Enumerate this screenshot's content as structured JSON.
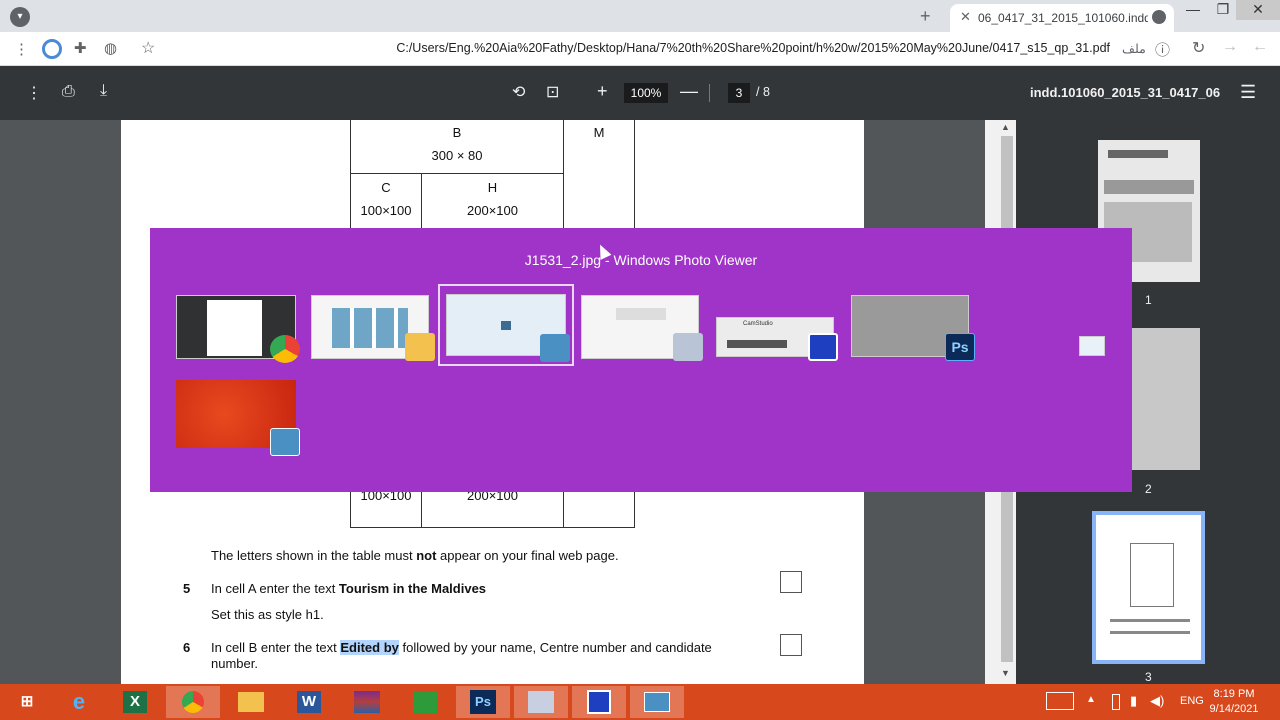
{
  "browser": {
    "tab_title": "06_0417_31_2015_101060.indd",
    "url": "C:/Users/Eng.%20Aia%20Fathy/Desktop/Hana/7%20th%20Share%20point/h%20w/2015%20May%20June/0417_s15_qp_31.pdf",
    "file_label": "ملف",
    "new_tab": "+",
    "tab_close": "✕"
  },
  "pdf_toolbar": {
    "zoom": "100%",
    "current_page": "3",
    "total_pages": "/  8",
    "document_name": "indd.101060_2015_31_0417_06"
  },
  "document": {
    "table": {
      "cell_b_label": "B",
      "cell_b_size": "300 × 80",
      "cell_m_label": "M",
      "cell_c_label": "C",
      "cell_c_size": "100×100",
      "cell_h_label": "H",
      "cell_h_size": "200×100",
      "lower_left_size": "100×100",
      "lower_mid_size": "200×100"
    },
    "note_prefix": "The letters shown in the table must ",
    "note_bold": "not",
    "note_suffix": " appear on your final web page.",
    "q5_number": "5",
    "q5_prefix": "In cell A enter the text ",
    "q5_bold": "Tourism in the Maldives",
    "q5_line2": "Set this as style h1.",
    "q6_number": "6",
    "q6_prefix": "In cell B enter the text ",
    "q6_bold": "Edited by",
    "q6_suffix": " followed by your name, Centre number and candidate",
    "q6_line2": "number."
  },
  "thumbnails": {
    "labels": [
      "1",
      "2",
      "3"
    ],
    "selected": "3"
  },
  "switcher": {
    "title": "J1531_2.jpg - Windows Photo Viewer",
    "windows": [
      {
        "app": "Chrome",
        "icon": "chrome-icon"
      },
      {
        "app": "File Explorer",
        "icon": "folder-icon"
      },
      {
        "app": "Windows Photo Viewer",
        "icon": "photo-viewer-icon",
        "selected": true
      },
      {
        "app": "Paint",
        "icon": "paint-icon"
      },
      {
        "app": "CamStudio",
        "icon": "camstudio-icon"
      },
      {
        "app": "Photoshop",
        "icon": "photoshop-icon",
        "badge_text": "Ps"
      },
      {
        "app": "Photo Viewer",
        "icon": "photo-viewer-small-icon"
      },
      {
        "app": "Desktop",
        "icon": "desktop-icon"
      }
    ],
    "camstudio_title": "CamStudio"
  },
  "taskbar": {
    "apps": [
      {
        "name": "start",
        "glyph": "⊞"
      },
      {
        "name": "internet-explorer",
        "glyph": "e"
      },
      {
        "name": "excel",
        "glyph": "X"
      },
      {
        "name": "chrome",
        "glyph": "◉"
      },
      {
        "name": "file-explorer",
        "glyph": "▤"
      },
      {
        "name": "word",
        "glyph": "W"
      },
      {
        "name": "winrar",
        "glyph": "▦"
      },
      {
        "name": "store",
        "glyph": "⊡"
      },
      {
        "name": "photoshop",
        "glyph": "Ps"
      },
      {
        "name": "paint",
        "glyph": "✎"
      },
      {
        "name": "camstudio",
        "glyph": "◧"
      },
      {
        "name": "photo-viewer",
        "glyph": "▭"
      }
    ],
    "language": "ENG",
    "time": "8:19 PM",
    "date": "9/14/2021"
  },
  "colors": {
    "switcher_bg": "#a033c8",
    "taskbar_bg": "#d8481d",
    "pdf_toolbar_bg": "#323639"
  }
}
